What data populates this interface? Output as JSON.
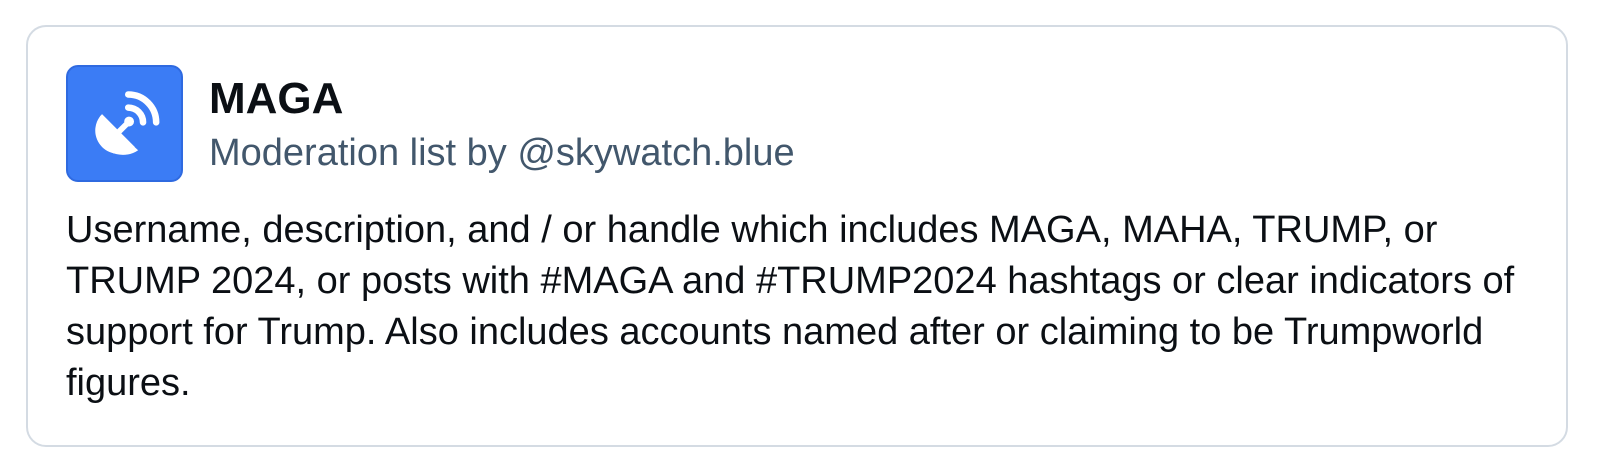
{
  "list": {
    "title": "MAGA",
    "subtitle": "Moderation list by @skywatch.blue",
    "description": "Username, description, and / or handle which includes MAGA, MAHA, TRUMP, or TRUMP 2024, or posts with #MAGA and #TRUMP2024 hashtags or clear indicators of support for Trump. Also includes accounts named after or claiming to be Trumpworld figures.",
    "avatar_icon": "satellite-dish-icon",
    "avatar_color": "#3b7cf5"
  }
}
